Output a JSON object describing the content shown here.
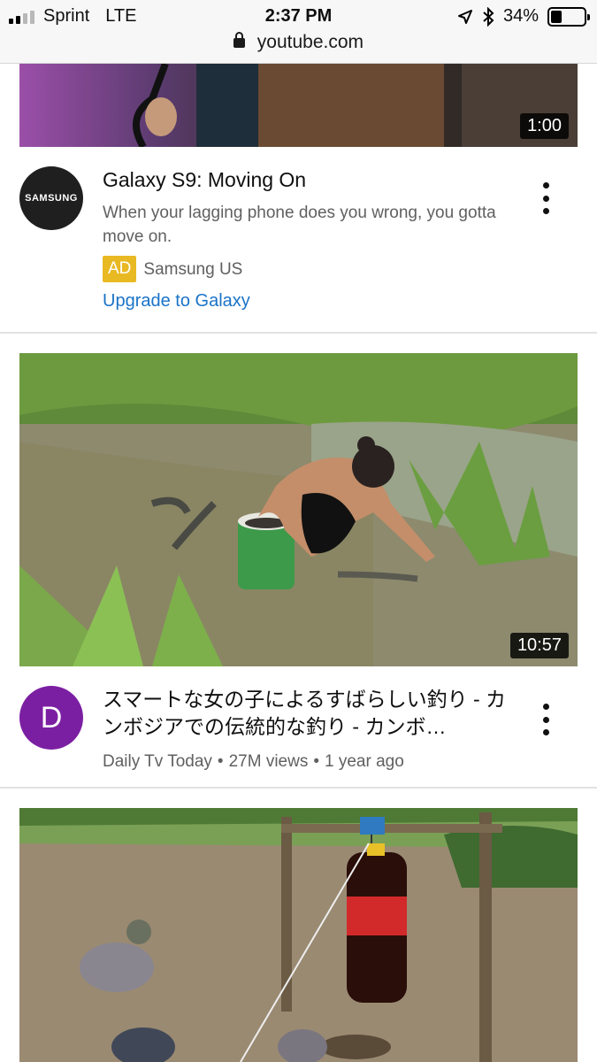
{
  "status_bar": {
    "carrier": "Sprint",
    "network": "LTE",
    "time": "2:37 PM",
    "battery": "34%",
    "battery_level": 0.34
  },
  "url_bar": {
    "domain": "youtube.com"
  },
  "feed": [
    {
      "type": "ad",
      "duration": "1:00",
      "avatar_text": "SAMSUNG",
      "title": "Galaxy S9: Moving On",
      "description": "When your lagging phone does you wrong, you gotta move on.",
      "ad_badge": "AD",
      "advertiser": "Samsung US",
      "cta": "Upgrade to Galaxy"
    },
    {
      "type": "video",
      "duration": "10:57",
      "avatar_text": "D",
      "avatar_color": "#7b1fa2",
      "title": "スマートな女の子によるすばらしい釣り - カンボジアでの伝統的な釣り - カンボ…",
      "channel": "Daily Tv Today",
      "views": "27M views",
      "age": "1 year ago"
    },
    {
      "type": "video"
    }
  ]
}
